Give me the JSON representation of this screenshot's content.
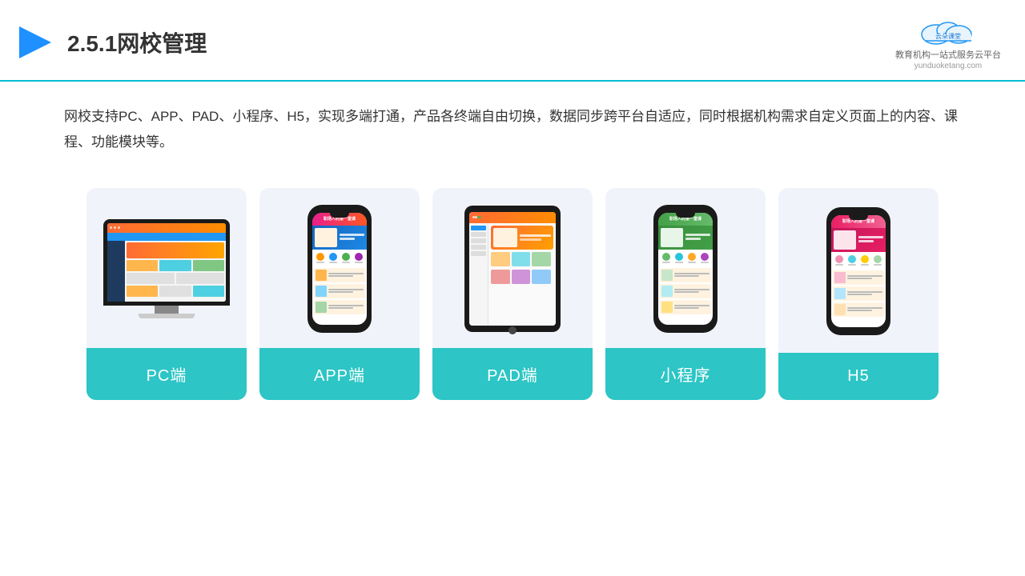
{
  "header": {
    "title": "2.5.1网校管理",
    "logo_main": "云朵课堂",
    "logo_sub": "yunduoketang.com",
    "logo_tag": "教育机构一站式服务云平台"
  },
  "description": "网校支持PC、APP、PAD、小程序、H5，实现多端打通，产品各终端自由切换，数据同步跨平台自适应，同时根据机构需求自定义页面上的内容、课程、功能模块等。",
  "cards": [
    {
      "label": "PC端",
      "device": "pc"
    },
    {
      "label": "APP端",
      "device": "phone"
    },
    {
      "label": "PAD端",
      "device": "tablet"
    },
    {
      "label": "小程序",
      "device": "mini-phone"
    },
    {
      "label": "H5",
      "device": "mini-phone2"
    }
  ]
}
